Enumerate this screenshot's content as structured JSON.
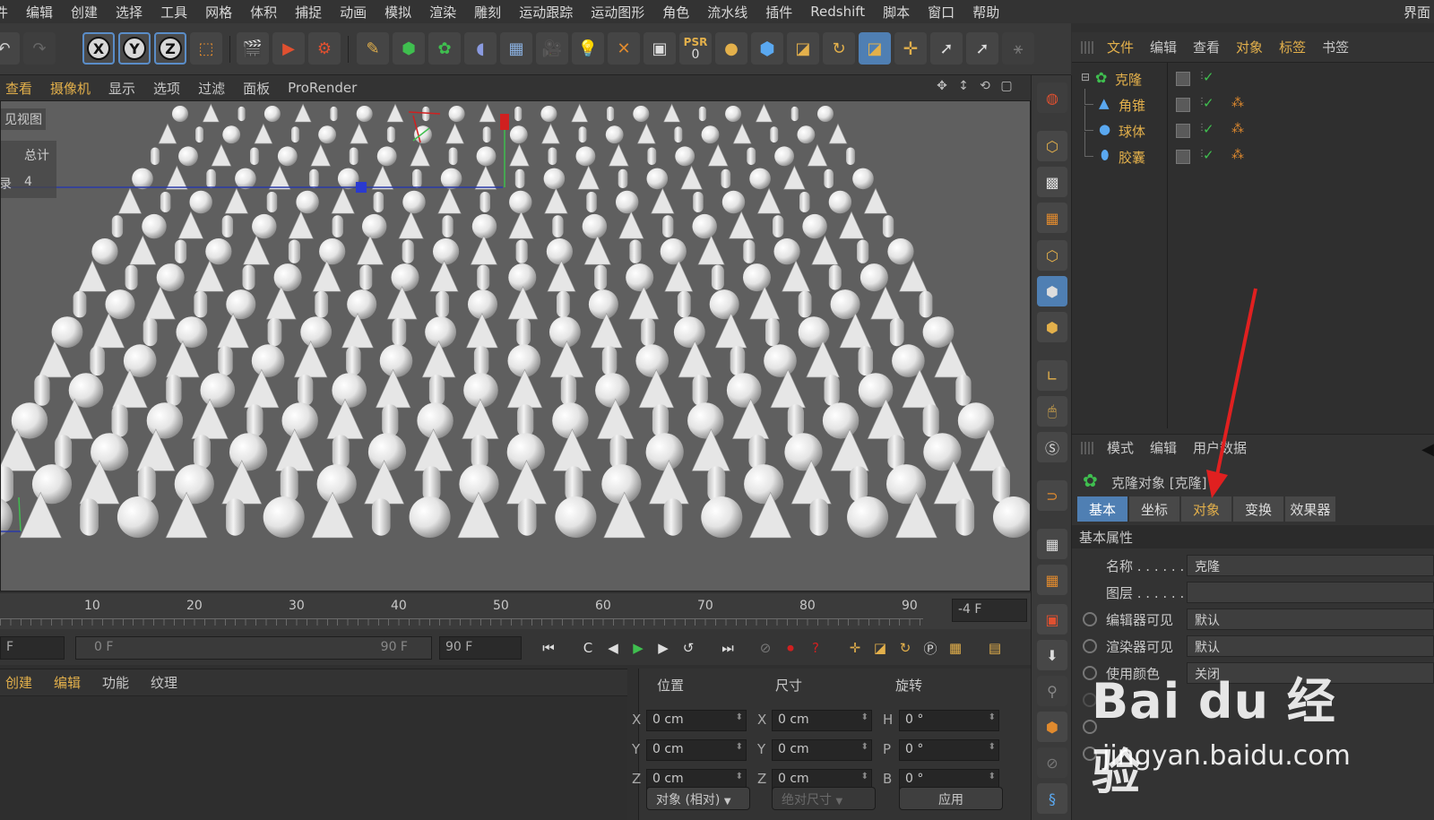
{
  "menubar": {
    "items": [
      "件",
      "编辑",
      "创建",
      "选择",
      "工具",
      "网格",
      "体积",
      "捕捉",
      "动画",
      "模拟",
      "渲染",
      "雕刻",
      "运动跟踪",
      "运动图形",
      "角色",
      "流水线",
      "插件",
      "Redshift",
      "脚本",
      "窗口",
      "帮助"
    ],
    "right_label": "界面"
  },
  "toolbar": {
    "axis_x": "X",
    "axis_y": "Y",
    "axis_z": "Z",
    "psr_label": "PSR",
    "psr_value": "0"
  },
  "viewport": {
    "menu": [
      "查看",
      "摄像机",
      "显示",
      "选项",
      "过滤",
      "面板",
      "ProRender"
    ],
    "label": "见视图",
    "stats_title": "总计",
    "stats_key": "录",
    "stats_value": "4",
    "background": "#5f5f5f"
  },
  "timeline": {
    "ticks": [
      "10",
      "20",
      "30",
      "40",
      "50",
      "60",
      "70",
      "80",
      "90"
    ],
    "current_frame": "-4 F"
  },
  "transport": {
    "start_field": "F",
    "range_start": "0 F",
    "range_end": "90 F",
    "end_field": "90 F"
  },
  "material_manager": {
    "menu": [
      "创建",
      "编辑",
      "功能",
      "纹理"
    ]
  },
  "coordinates": {
    "headers": [
      "位置",
      "尺寸",
      "旋转"
    ],
    "position": [
      {
        "axis": "X",
        "value": "0 cm"
      },
      {
        "axis": "Y",
        "value": "0 cm"
      },
      {
        "axis": "Z",
        "value": "0 cm"
      }
    ],
    "size": [
      {
        "axis": "X",
        "value": "0 cm"
      },
      {
        "axis": "Y",
        "value": "0 cm"
      },
      {
        "axis": "Z",
        "value": "0 cm"
      }
    ],
    "rotation": [
      {
        "axis": "H",
        "value": "0 °"
      },
      {
        "axis": "P",
        "value": "0 °"
      },
      {
        "axis": "B",
        "value": "0 °"
      }
    ],
    "mode_dropdown": "对象 (相对)",
    "size_dropdown": "绝对尺寸",
    "apply_button": "应用"
  },
  "object_manager": {
    "menu": [
      "文件",
      "编辑",
      "查看",
      "对象",
      "标签",
      "书签"
    ],
    "objects": [
      {
        "name": "克隆",
        "color": "#e3b04b"
      },
      {
        "name": "角锥",
        "color": "#e3b04b"
      },
      {
        "name": "球体",
        "color": "#e3b04b"
      },
      {
        "name": "胶囊",
        "color": "#e3b04b"
      }
    ]
  },
  "attribute_manager": {
    "menu": [
      "模式",
      "编辑",
      "用户数据"
    ],
    "title": "克隆对象 [克隆]",
    "tabs": [
      "基本",
      "坐标",
      "对象",
      "变换",
      "效果器"
    ],
    "section": "基本属性",
    "rows": [
      {
        "label": "名称 . . . . . .",
        "value": "克隆"
      },
      {
        "label": "图层 . . . . . .",
        "value": ""
      },
      {
        "label": "编辑器可见",
        "value": "默认"
      },
      {
        "label": "渲染器可见",
        "value": "默认"
      },
      {
        "label": "使用颜色",
        "value": "关闭"
      }
    ]
  },
  "watermark": {
    "logo": "Bai du 经验",
    "url": "jingyan.baidu.com"
  },
  "colors": {
    "accent": "#4f7fb3",
    "highlight": "#e3b04b",
    "annotation": "#e02020"
  }
}
